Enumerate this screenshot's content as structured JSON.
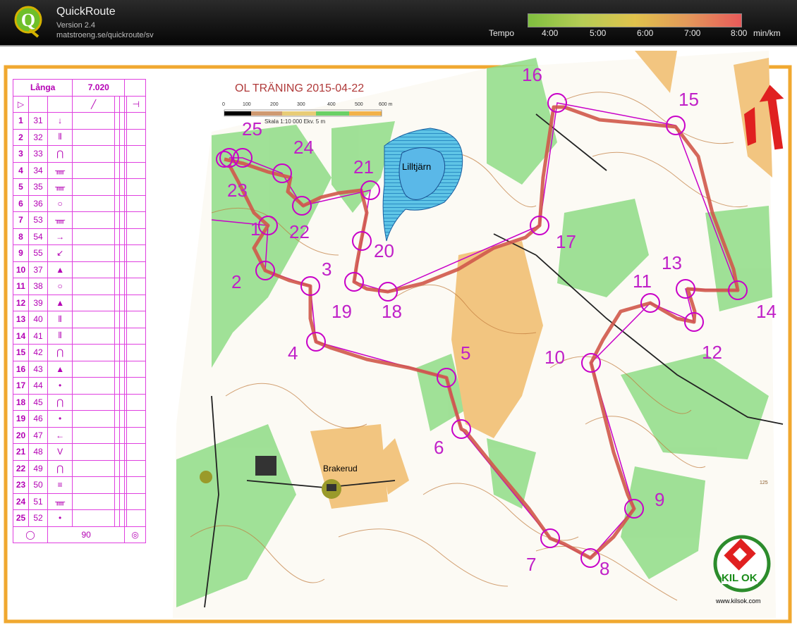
{
  "app": {
    "title": "QuickRoute",
    "version": "Version 2.4",
    "url": "matstroeng.se/quickroute/sv"
  },
  "tempo": {
    "label": "Tempo",
    "ticks": [
      "4:00",
      "5:00",
      "6:00",
      "7:00",
      "8:00"
    ],
    "unit": "min/km"
  },
  "map": {
    "title": "OL TRÄNING 2015-04-22",
    "scale_ticks": [
      "0",
      "100",
      "200",
      "300",
      "400",
      "500",
      "600 m"
    ],
    "scale_text": "Skala 1:10 000    Ekv. 5 m",
    "place_lake": "Lilltjärn",
    "place_village": "Brakerud",
    "contour_number": "125",
    "club_name": "KIL OK",
    "club_url": "www.kilsok.com",
    "colors": {
      "course": "#c800c8",
      "route": "#c0504d",
      "frame": "#f0a830",
      "forest": "#7ed67a",
      "open": "#f3c27a"
    }
  },
  "course": {
    "name": "Långa",
    "length": "7.020",
    "finish_distance": "90",
    "controls": [
      {
        "num": "1",
        "code": "31",
        "symbol": "↓"
      },
      {
        "num": "2",
        "code": "32",
        "symbol": "⫴"
      },
      {
        "num": "3",
        "code": "33",
        "symbol": "⋂"
      },
      {
        "num": "4",
        "code": "34",
        "symbol": "ᚄ"
      },
      {
        "num": "5",
        "code": "35",
        "symbol": "ᚄ"
      },
      {
        "num": "6",
        "code": "36",
        "symbol": "○"
      },
      {
        "num": "7",
        "code": "53",
        "symbol": "ᚄ"
      },
      {
        "num": "8",
        "code": "54",
        "symbol": "→"
      },
      {
        "num": "9",
        "code": "55",
        "symbol": "↙"
      },
      {
        "num": "10",
        "code": "37",
        "symbol": "▲"
      },
      {
        "num": "11",
        "code": "38",
        "symbol": "○"
      },
      {
        "num": "12",
        "code": "39",
        "symbol": "▲"
      },
      {
        "num": "13",
        "code": "40",
        "symbol": "⫴"
      },
      {
        "num": "14",
        "code": "41",
        "symbol": "⫴"
      },
      {
        "num": "15",
        "code": "42",
        "symbol": "⋂"
      },
      {
        "num": "16",
        "code": "43",
        "symbol": "▲"
      },
      {
        "num": "17",
        "code": "44",
        "symbol": "•"
      },
      {
        "num": "18",
        "code": "45",
        "symbol": "⋂"
      },
      {
        "num": "19",
        "code": "46",
        "symbol": "•"
      },
      {
        "num": "20",
        "code": "47",
        "symbol": "←"
      },
      {
        "num": "21",
        "code": "48",
        "symbol": "V"
      },
      {
        "num": "22",
        "code": "49",
        "symbol": "⋂"
      },
      {
        "num": "23",
        "code": "50",
        "symbol": "≡"
      },
      {
        "num": "24",
        "code": "51",
        "symbol": "ᚄ"
      },
      {
        "num": "25",
        "code": "52",
        "symbol": "•"
      }
    ]
  }
}
